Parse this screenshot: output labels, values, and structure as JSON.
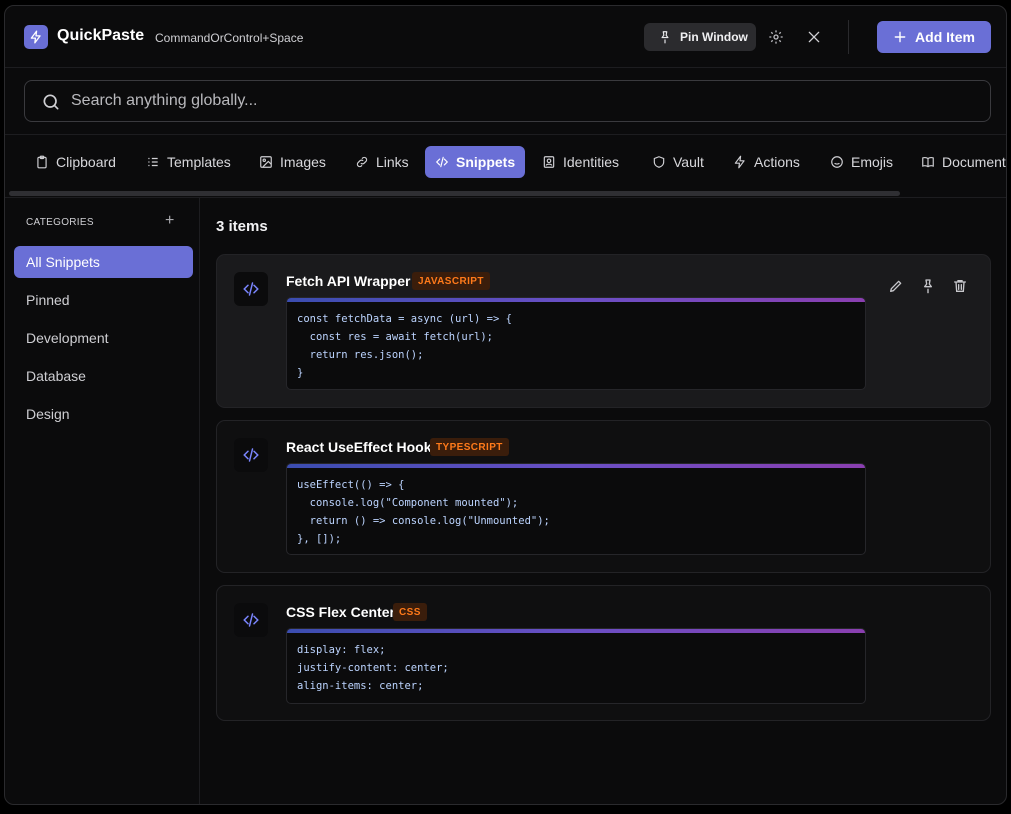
{
  "header": {
    "app_title": "QuickPaste",
    "shortcut": "CommandOrControl+Space",
    "pin_label": "Pin Window",
    "add_label": "Add Item"
  },
  "search": {
    "placeholder": "Search anything globally..."
  },
  "tabs": [
    {
      "label": "Clipboard",
      "icon": "clipboard-icon"
    },
    {
      "label": "Templates",
      "icon": "list-icon"
    },
    {
      "label": "Images",
      "icon": "image-icon"
    },
    {
      "label": "Links",
      "icon": "link-icon"
    },
    {
      "label": "Snippets",
      "icon": "code-icon",
      "active": true
    },
    {
      "label": "Identities",
      "icon": "id-card-icon"
    },
    {
      "label": "Vault",
      "icon": "shield-icon"
    },
    {
      "label": "Actions",
      "icon": "bolt-icon"
    },
    {
      "label": "Emojis",
      "icon": "smile-icon"
    },
    {
      "label": "Documents",
      "icon": "book-icon"
    }
  ],
  "sidebar": {
    "heading": "CATEGORIES",
    "items": [
      {
        "label": "All Snippets",
        "active": true
      },
      {
        "label": "Pinned"
      },
      {
        "label": "Development"
      },
      {
        "label": "Database"
      },
      {
        "label": "Design"
      }
    ]
  },
  "main": {
    "count_label": "3 items",
    "snippets": [
      {
        "title": "Fetch API Wrapper",
        "language": "JAVASCRIPT",
        "code": "const fetchData = async (url) => {\n  const res = await fetch(url);\n  return res.json();\n}"
      },
      {
        "title": "React UseEffect Hook",
        "language": "TYPESCRIPT",
        "code": "useEffect(() => {\n  console.log(\"Component mounted\");\n  return () => console.log(\"Unmounted\");\n}, []);"
      },
      {
        "title": "CSS Flex Center",
        "language": "CSS",
        "code": "display: flex;\njustify-content: center;\nalign-items: center;"
      }
    ]
  },
  "colors": {
    "accent": "#6a6fd6",
    "badge_text": "#ff7a1a",
    "badge_bg": "#3a1d0b"
  }
}
